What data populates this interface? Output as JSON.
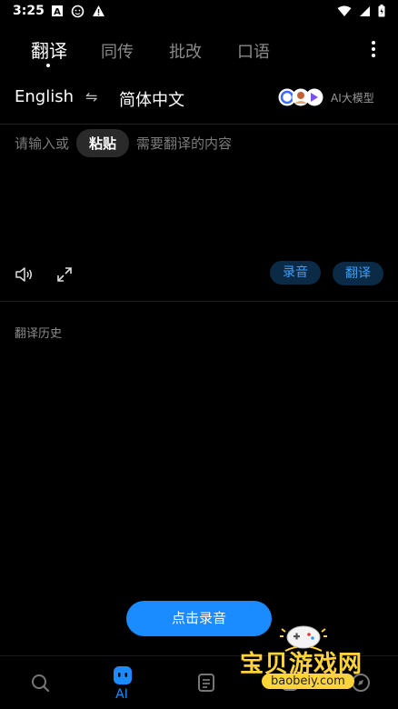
{
  "status_bar": {
    "time": "3:25",
    "icons": [
      "a-box-icon",
      "face-id-icon",
      "warning-icon",
      "wifi-icon",
      "signal-icon",
      "battery-icon"
    ]
  },
  "tabs": [
    {
      "label": "翻译",
      "active": true
    },
    {
      "label": "同传",
      "active": false
    },
    {
      "label": "批改",
      "active": false
    },
    {
      "label": "口语",
      "active": false
    }
  ],
  "language": {
    "source": "English",
    "swap_symbol": "⇋",
    "target": "简体中文",
    "ai_label": "AI大模型"
  },
  "input": {
    "prefix": "请输入或",
    "paste_label": "粘贴",
    "suffix": "需要翻译的内容"
  },
  "actions": {
    "record_label": "录音",
    "translate_label": "翻译"
  },
  "history_label": "翻译历史",
  "record_button_label": "点击录音",
  "bottom_nav": [
    {
      "name": "search",
      "label": ""
    },
    {
      "name": "ai",
      "label": "AI"
    },
    {
      "name": "notes",
      "label": ""
    },
    {
      "name": "tools",
      "label": ""
    },
    {
      "name": "compass",
      "label": ""
    }
  ],
  "watermark": {
    "text": "宝贝游戏网",
    "url": "baobeiy.com"
  },
  "colors": {
    "accent": "#1a8cff",
    "background": "#000000",
    "muted": "#8a8a8a"
  }
}
